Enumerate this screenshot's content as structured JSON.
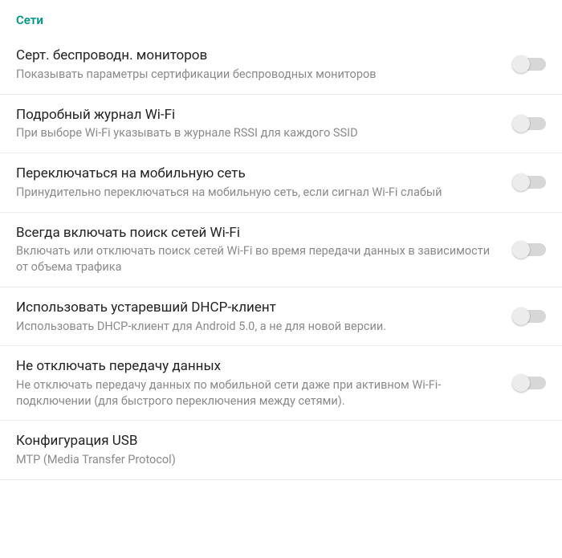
{
  "section_header": "Сети",
  "items": [
    {
      "title": "Серт. беспроводн. мониторов",
      "subtitle": "Показывать параметры сертификации беспроводных мониторов",
      "has_switch": true
    },
    {
      "title": "Подробный журнал Wi-Fi",
      "subtitle": "При выборе Wi-Fi указывать в журнале RSSI для каждого SSID",
      "has_switch": true
    },
    {
      "title": "Переключаться на мобильную сеть",
      "subtitle": "Принудительно переключаться на мобильную сеть, если сигнал Wi-Fi слабый",
      "has_switch": true
    },
    {
      "title": "Всегда включать поиск сетей Wi-Fi",
      "subtitle": "Включать или отключать поиск сетей Wi-Fi во время передачи данных в зависимости от объема трафика",
      "has_switch": true
    },
    {
      "title": "Использовать устаревший DHCP-клиент",
      "subtitle": "Использовать DHCP-клиент для Android 5.0, а не для новой версии.",
      "has_switch": true
    },
    {
      "title": "Не отключать передачу данных",
      "subtitle": "Не отключать передачу данных по мобильной сети даже при активном Wi-Fi-подключении (для быстрого переключения между сетями).",
      "has_switch": true
    },
    {
      "title": "Конфигурация USB",
      "subtitle": "MTP (Media Transfer Protocol)",
      "has_switch": false
    }
  ]
}
